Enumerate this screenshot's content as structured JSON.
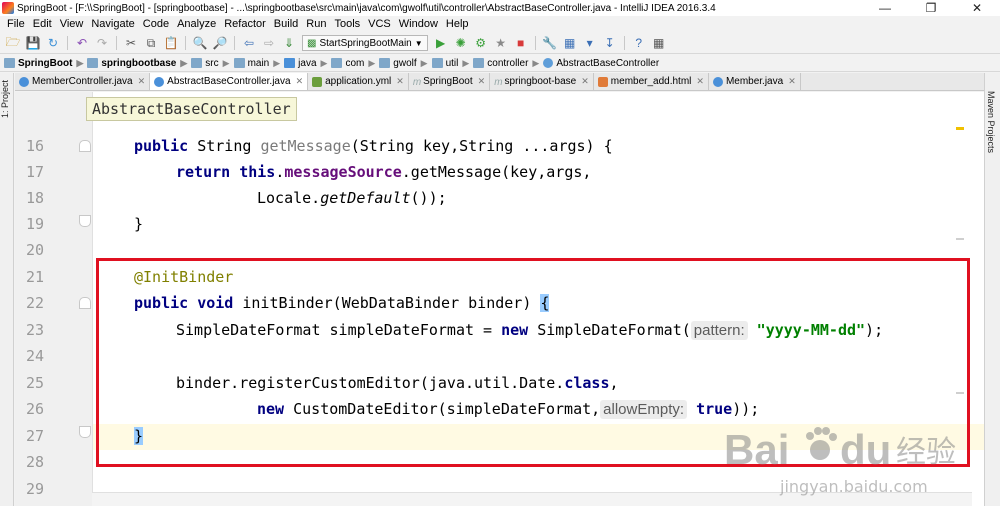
{
  "window": {
    "title": "SpringBoot - [F:\\\\SpringBoot] - [springbootbase] - ...\\springbootbase\\src\\main\\java\\com\\gwolf\\util\\controller\\AbstractBaseController.java - IntelliJ IDEA 2016.3.4"
  },
  "menu": [
    "File",
    "Edit",
    "View",
    "Navigate",
    "Code",
    "Analyze",
    "Refactor",
    "Build",
    "Run",
    "Tools",
    "VCS",
    "Window",
    "Help"
  ],
  "toolbar": {
    "run_config": "StartSpringBootMain"
  },
  "breadcrumbs": [
    "SpringBoot",
    "springbootbase",
    "src",
    "main",
    "java",
    "com",
    "gwolf",
    "util",
    "controller",
    "AbstractBaseController"
  ],
  "side_panels": {
    "left": "1: Project",
    "right": "Maven Projects"
  },
  "tabs": [
    "MemberController.java",
    "AbstractBaseController.java",
    "application.yml",
    "SpringBoot",
    "springboot-base",
    "member_add.html",
    "Member.java"
  ],
  "active_tab": "AbstractBaseController.java",
  "tooltip": "AbstractBaseController",
  "code": {
    "line_numbers": [
      "16",
      "17",
      "18",
      "19",
      "20",
      "21",
      "22",
      "23",
      "24",
      "25",
      "26",
      "27",
      "28",
      "29"
    ],
    "l16": {
      "kw": "public",
      "type": "String",
      "name": "getMessage",
      "params": "(String key,String ...args) {"
    },
    "l17": {
      "kw": "return",
      "this": "this",
      "dot": ".",
      "field": "messageSource",
      "rest": ".getMessage(key,args,"
    },
    "l18": {
      "cls": "Locale.",
      "method": "getDefault",
      "rest": "());"
    },
    "l19": {
      "text": "}"
    },
    "l21": {
      "ann": "@InitBinder"
    },
    "l22": {
      "kw1": "public",
      "kw2": "void",
      "rest": "initBinder(WebDataBinder binder)",
      "brace": "{"
    },
    "l23": {
      "decl": "SimpleDateFormat simpleDateFormat = ",
      "kw": "new",
      "ctor": "SimpleDateFormat(",
      "hint": "pattern:",
      "str": "\"yyyy-MM-dd\"",
      "end": ");"
    },
    "l25": {
      "call": "binder.registerCustomEditor(java.util.Date.",
      "kw": "class",
      "end": ","
    },
    "l26": {
      "kw": "new",
      "ctor": "CustomDateEditor(simpleDateFormat,",
      "hint": "allowEmpty:",
      "val": "true",
      "end": "));"
    },
    "l27": {
      "brace": "}"
    }
  },
  "watermark": {
    "brand": "Bai",
    "brand2": "du",
    "cn": "经验",
    "url": "jingyan.baidu.com"
  },
  "colors": {
    "annotation_box": "#e01020",
    "keyword": "#000080",
    "string": "#008000",
    "annotation": "#808000",
    "field": "#660e7a"
  }
}
